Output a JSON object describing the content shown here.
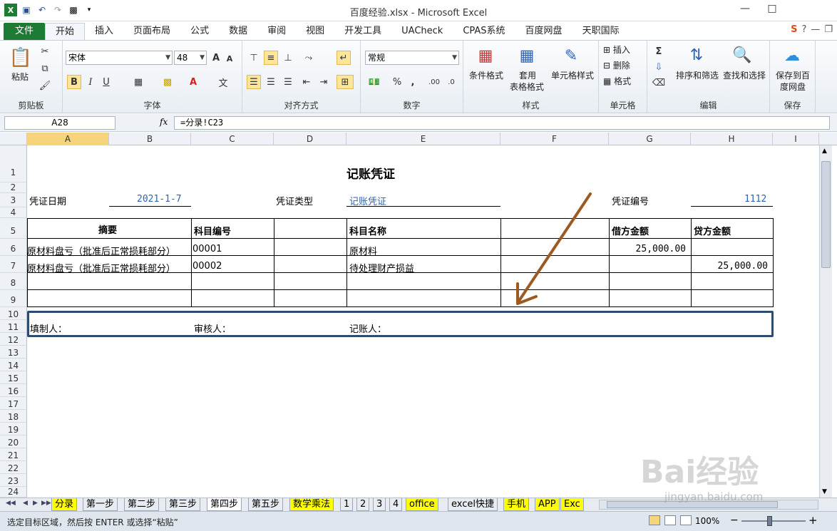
{
  "window": {
    "title": "百度经验.xlsx - Microsoft Excel"
  },
  "ribbon_tabs": [
    "文件",
    "开始",
    "插入",
    "页面布局",
    "公式",
    "数据",
    "审阅",
    "视图",
    "开发工具",
    "UACheck",
    "CPAS系统",
    "百度网盘",
    "天职国际"
  ],
  "ribbon": {
    "clipboard": {
      "label": "剪贴板",
      "paste": "粘贴"
    },
    "font": {
      "label": "字体",
      "name": "宋体",
      "size": "48",
      "bold": "B",
      "italic": "I",
      "underline": "U",
      "grow": "A",
      "shrink": "A"
    },
    "alignment": {
      "label": "对齐方式"
    },
    "number": {
      "label": "数字",
      "format": "常规",
      "percent": "%",
      "comma": ",",
      "inc": ".00",
      "dec": ".0"
    },
    "styles": {
      "label": "样式",
      "conditional": "条件格式",
      "table1": "套用",
      "table2": "表格格式",
      "cell": "单元格样式"
    },
    "cells": {
      "label": "单元格",
      "insert": "插入",
      "delete": "删除",
      "format": "格式"
    },
    "editing": {
      "label": "编辑",
      "sort": "排序和筛选",
      "find": "查找和选择"
    },
    "save": {
      "label": "保存",
      "btn1": "保存到百",
      "btn2": "度网盘"
    }
  },
  "formula_bar": {
    "name_box": "A28",
    "fx": "fx",
    "formula": "=分录!C23"
  },
  "columns": [
    "A",
    "B",
    "C",
    "D",
    "E",
    "F",
    "G",
    "H",
    "I"
  ],
  "rows": [
    "1",
    "2",
    "3",
    "4",
    "5",
    "6",
    "7",
    "8",
    "9",
    "10",
    "11",
    "12",
    "13",
    "14",
    "15",
    "16",
    "17",
    "18",
    "19",
    "20",
    "21",
    "22",
    "23",
    "24"
  ],
  "voucher": {
    "title": "记账凭证",
    "date_label": "凭证日期",
    "date_value": "2021-1-7",
    "type_label": "凭证类型",
    "type_value": "记账凭证",
    "number_label": "凭证编号",
    "number_value": "1112",
    "headers": {
      "summary": "摘要",
      "account_code": "科目编号",
      "account_name": "科目名称",
      "debit": "借方金额",
      "credit": "贷方金额"
    },
    "entries": [
      {
        "summary": "原材料盘亏（批准后正常损耗部分）",
        "code": "00001",
        "name": "原材料",
        "debit": "25,000.00",
        "credit": ""
      },
      {
        "summary": "原材料盘亏（批准后正常损耗部分）",
        "code": "00002",
        "name": "待处理财产损益",
        "debit": "",
        "credit": "25,000.00"
      }
    ],
    "preparer": "填制人：",
    "reviewer": "审核人：",
    "bookkeeper": "记账人："
  },
  "sheet_tabs": [
    {
      "name": "分录",
      "style": "yellow"
    },
    {
      "name": "第一步",
      "style": "normal"
    },
    {
      "name": "第二步",
      "style": "normal"
    },
    {
      "name": "第三步",
      "style": "normal"
    },
    {
      "name": "第四步",
      "style": "active"
    },
    {
      "name": "第五步",
      "style": "normal"
    },
    {
      "name": "数学乘法",
      "style": "yellow"
    },
    {
      "name": "1",
      "style": "normal"
    },
    {
      "name": "2",
      "style": "normal"
    },
    {
      "name": "3",
      "style": "normal"
    },
    {
      "name": "4",
      "style": "normal"
    },
    {
      "name": "office",
      "style": "yellow"
    },
    {
      "name": "excel快捷",
      "style": "normal"
    },
    {
      "name": "手机",
      "style": "yellow"
    },
    {
      "name": "APP",
      "style": "yellow"
    },
    {
      "name": "Exc",
      "style": "yellow"
    }
  ],
  "status": {
    "message": "选定目标区域，然后按 ENTER 或选择“粘贴”",
    "zoom": "100%",
    "zoom_minus": "−",
    "zoom_plus": "+"
  },
  "watermark": {
    "logo": "Bai经验",
    "url": "jingyan.baidu.com"
  },
  "colors": {
    "accent_green": "#1e7b34",
    "selected_header": "#f5d47b",
    "arrow": "#9c5a21",
    "blue_text": "#2c64b4",
    "frame": "#2f4b6e"
  }
}
